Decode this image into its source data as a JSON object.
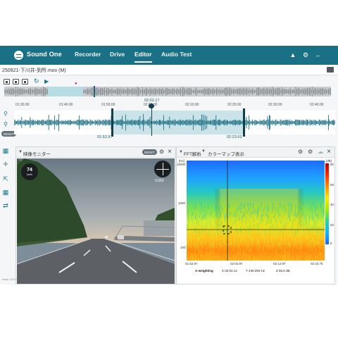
{
  "app": {
    "brand": "Sound One",
    "nav": [
      "Recorder",
      "Drive",
      "Editor",
      "Audio Test"
    ],
    "active_tab": "Editor"
  },
  "file": {
    "name": "250921-下川井-到所.mov (M)"
  },
  "timeline": {
    "cursor_time": "02:02.17",
    "ticks": [
      "01:30.00",
      "01:40.00",
      "01:50.00",
      "02:00.00",
      "02:10.00",
      "02:20.00",
      "02:30.00",
      "02:40.00"
    ],
    "selection_start": "01:52.97",
    "selection_end": "02:23.63",
    "reset_label": "RESET"
  },
  "video_panel": {
    "title": "映像モニター",
    "reset_label": "RESET",
    "speed_value": "74",
    "speed_unit": "km/h",
    "compass_value": "0.050"
  },
  "fft_panel": {
    "title": "FFT解析",
    "second_title": "カラーマップ表示",
    "y_unit": "[Hz]",
    "colorbar_unit": "[dB]",
    "y_ticks": [
      "10000",
      "1000",
      "100"
    ],
    "colorbar_ticks": [
      "80",
      "60",
      "40",
      "20",
      "0"
    ],
    "x_ticks": [
      "01:52.97",
      "02:02.97",
      "02:12.97",
      "02:23.75"
    ],
    "footer": {
      "weighting": "A-weighting",
      "x": "X 02:02.14",
      "y": "Y 246.093 Hz",
      "z": "Z 56.6 dB"
    }
  },
  "version": "ssion 23.0.0",
  "colors": {
    "header": "#1a7185",
    "accent": "#1b7586",
    "selection": "#c9e3e9"
  },
  "icons": [
    "bell-icon",
    "gear-icon",
    "logout-icon",
    "folder-icon",
    "zoom-in-icon",
    "zoom-out-icon",
    "video-monitor-icon",
    "crosshair-icon",
    "export-icon",
    "grid-icon",
    "swap-icon"
  ]
}
